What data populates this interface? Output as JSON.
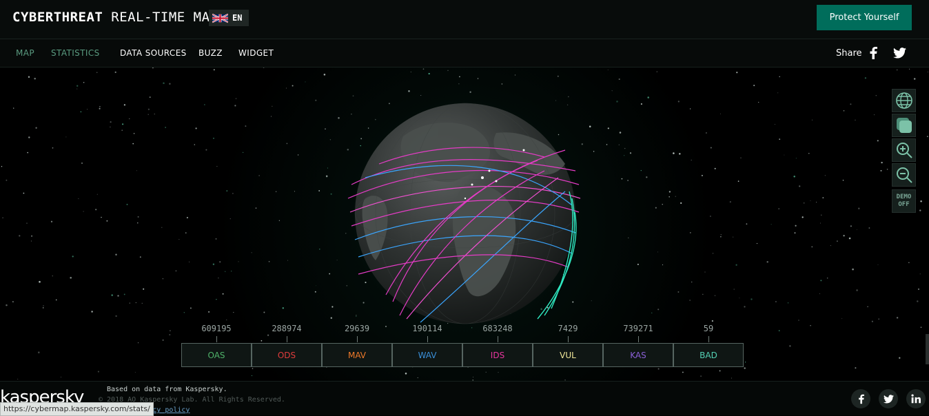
{
  "header": {
    "brand_bold": "CYBERTHREAT",
    "brand_rest": " REAL-TIME MAP",
    "language": "EN",
    "flag_icon": "uk-flag-icon",
    "cta_label": "Protect Yourself",
    "cta_color": "#006d5b"
  },
  "nav": {
    "items": [
      {
        "label": "MAP",
        "active": true
      },
      {
        "label": "STATISTICS",
        "active": true
      },
      {
        "label": "DATA SOURCES",
        "active": false
      },
      {
        "label": "BUZZ",
        "active": false
      },
      {
        "label": "WIDGET",
        "active": false
      }
    ],
    "share_label": "Share",
    "share_icons": [
      "facebook-icon",
      "twitter-icon"
    ]
  },
  "map_tools": {
    "icons": [
      "globe-icon",
      "flat-map-icon",
      "zoom-in-icon",
      "zoom-out-icon"
    ],
    "demo_line1": "DEMO",
    "demo_line2": "OFF"
  },
  "stats": [
    {
      "code": "OAS",
      "value": "609195",
      "color": "#4fb36a"
    },
    {
      "code": "ODS",
      "value": "288974",
      "color": "#e03c3c"
    },
    {
      "code": "MAV",
      "value": "29639",
      "color": "#f07a2a"
    },
    {
      "code": "WAV",
      "value": "190114",
      "color": "#3a8fd8"
    },
    {
      "code": "IDS",
      "value": "683248",
      "color": "#e8359e"
    },
    {
      "code": "VUL",
      "value": "7429",
      "color": "#f1e89a"
    },
    {
      "code": "KAS",
      "value": "739271",
      "color": "#8a5fd6"
    },
    {
      "code": "BAD",
      "value": "59",
      "color": "#54d0b4"
    }
  ],
  "footer": {
    "logo": "kaspersky",
    "based_on": "Based on data from Kaspersky.",
    "copyright": "© 2018 AO Kaspersky Lab. All Rights Reserved.",
    "links": "Service Privacy policy",
    "status_url": "https://cybermap.kaspersky.com/stats/",
    "social_icons": [
      "facebook-icon",
      "twitter-icon",
      "linkedin-icon"
    ]
  }
}
